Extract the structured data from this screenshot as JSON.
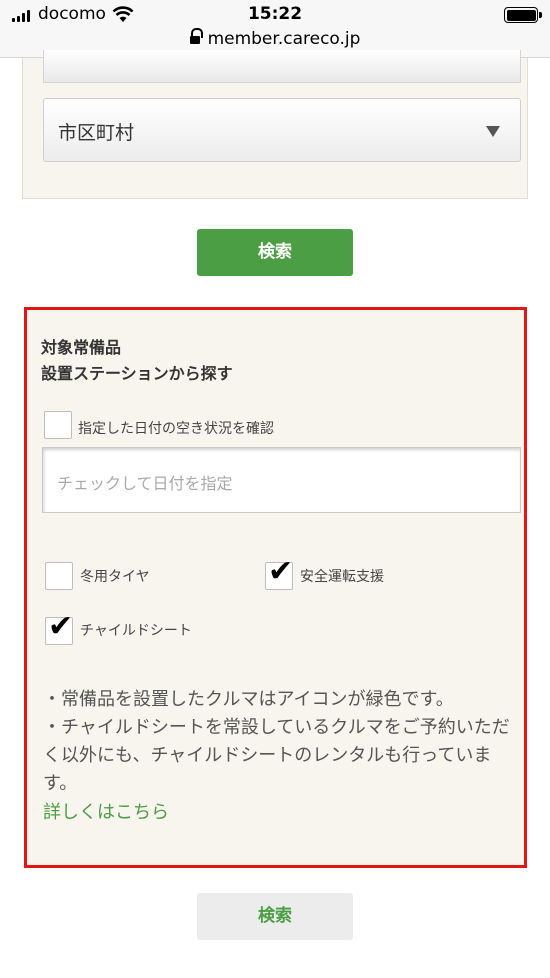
{
  "status_bar": {
    "carrier": "docomo",
    "time": "15:22",
    "url": "member.careco.jp"
  },
  "search_panel": {
    "city_select": {
      "label": "市区町村"
    },
    "search_button_label": "検索"
  },
  "equipment_panel": {
    "title_line1": "対象常備品",
    "title_line2": "設置ステーションから探す",
    "date_check": {
      "label": "指定した日付の空き状況を確認",
      "checked": false
    },
    "date_input": {
      "placeholder": "チェックして日付を指定",
      "value": ""
    },
    "options": [
      {
        "label": "冬用タイヤ",
        "checked": false
      },
      {
        "label": "安全運転支援",
        "checked": true
      },
      {
        "label": "チャイルドシート",
        "checked": true
      }
    ],
    "notes": [
      "・常備品を設置したクルマはアイコンが緑色です。",
      "・チャイルドシートを常設しているクルマをご予約いただく以外にも、チャイルドシートのレンタルも行っています。"
    ],
    "detail_link": "詳しくはこちら"
  },
  "bottom_search_button_label": "検索",
  "colors": {
    "brand_green": "#4c9e44",
    "highlight_red": "#e31612",
    "panel_bg": "#f8f5ee"
  }
}
